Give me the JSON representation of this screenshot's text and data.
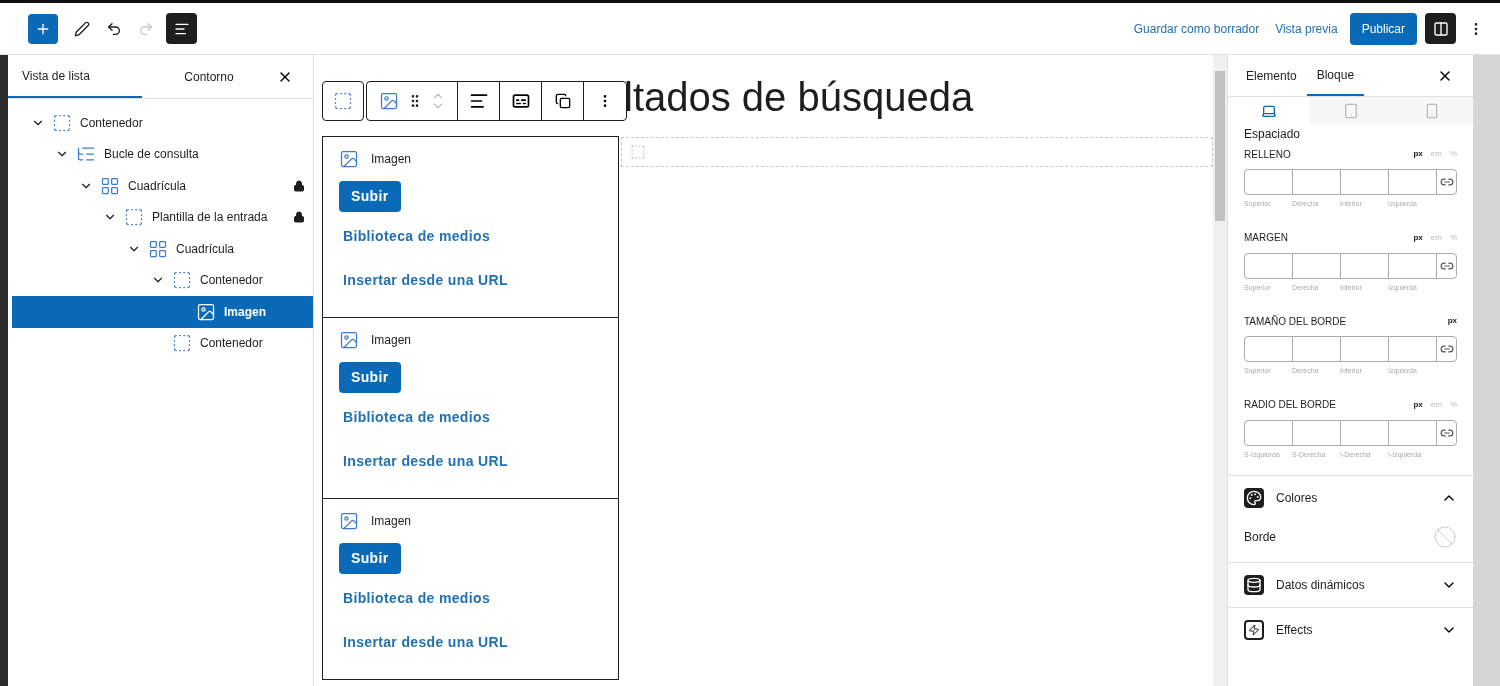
{
  "top_bar": {
    "save_draft": "Guardar como borrador",
    "preview": "Vista previa",
    "publish": "Publicar",
    "list_view_active": true,
    "settings_active": true
  },
  "left_panel": {
    "tabs": [
      {
        "label": "Vista de lista",
        "selected": true
      },
      {
        "label": "Contorno",
        "selected": false
      }
    ],
    "tree": [
      {
        "label": "Contenedor",
        "kind": "container",
        "locked": false,
        "selected": false,
        "expanded": true,
        "children": [
          {
            "label": "Bucle de consulta",
            "kind": "query",
            "locked": false,
            "selected": false,
            "expanded": true,
            "children": [
              {
                "label": "Cuadrícula",
                "kind": "grid",
                "locked": true,
                "selected": false,
                "expanded": true,
                "children": [
                  {
                    "label": "Plantilla de la entrada",
                    "kind": "container",
                    "locked": true,
                    "selected": false,
                    "expanded": true,
                    "children": [
                      {
                        "label": "Cuadrícula",
                        "kind": "grid",
                        "locked": false,
                        "selected": false,
                        "expanded": true,
                        "children": [
                          {
                            "label": "Contenedor",
                            "kind": "container",
                            "locked": false,
                            "selected": false,
                            "expanded": true,
                            "children": [
                              {
                                "label": "Imagen",
                                "kind": "image",
                                "locked": false,
                                "selected": true
                              }
                            ]
                          },
                          {
                            "label": "Contenedor",
                            "kind": "container",
                            "locked": false,
                            "selected": false
                          }
                        ]
                      }
                    ]
                  }
                ]
              }
            ]
          }
        ]
      }
    ]
  },
  "canvas": {
    "heading": "ltados de búsqueda",
    "cards": [
      {
        "label": "Imagen",
        "upload": "Subir",
        "media": "Biblioteca de medios",
        "url": "Insertar desde una URL"
      },
      {
        "label": "Imagen",
        "upload": "Subir",
        "media": "Biblioteca de medios",
        "url": "Insertar desde una URL"
      },
      {
        "label": "Imagen",
        "upload": "Subir",
        "media": "Biblioteca de medios",
        "url": "Insertar desde una URL"
      }
    ]
  },
  "right_panel": {
    "tabs": [
      {
        "label": "Elemento",
        "selected": false
      },
      {
        "label": "Bloque",
        "selected": true
      }
    ],
    "devices": [
      {
        "kind": "desktop",
        "selected": true
      },
      {
        "kind": "tablet",
        "selected": false
      },
      {
        "kind": "mobile",
        "selected": false
      }
    ],
    "section_title": "Espaciado",
    "groups": [
      {
        "title": "RELLENO",
        "units": [
          {
            "label": "px",
            "selected": true
          },
          {
            "label": "em",
            "selected": false
          },
          {
            "label": "%",
            "selected": false
          }
        ],
        "sides": [
          "Superior",
          "Derecha",
          "Inferior",
          "Izquierda"
        ]
      },
      {
        "title": "MARGEN",
        "units": [
          {
            "label": "px",
            "selected": true
          },
          {
            "label": "em",
            "selected": false
          },
          {
            "label": "%",
            "selected": false
          }
        ],
        "sides": [
          "Superior",
          "Derecha",
          "Inferior",
          "Izquierda"
        ]
      },
      {
        "title": "TAMAÑO DEL BORDE",
        "units": [
          {
            "label": "px",
            "selected": true
          }
        ],
        "sides": [
          "Superior",
          "Derecha",
          "Inferior",
          "Izquierda"
        ]
      },
      {
        "title": "RADIO DEL BORDE",
        "units": [
          {
            "label": "px",
            "selected": true
          },
          {
            "label": "em",
            "selected": false
          },
          {
            "label": "%",
            "selected": false
          }
        ],
        "sides": [
          "S-Izquierda",
          "S-Derecha",
          "I-Derecha",
          "I-Izquierda"
        ]
      }
    ],
    "panels": [
      {
        "title": "Colores",
        "kind": "palette",
        "expanded": true,
        "items": [
          "Borde"
        ]
      },
      {
        "title": "Datos dinámicos",
        "kind": "database",
        "expanded": false
      },
      {
        "title": "Effects",
        "kind": "bolt",
        "expanded": false
      }
    ]
  }
}
